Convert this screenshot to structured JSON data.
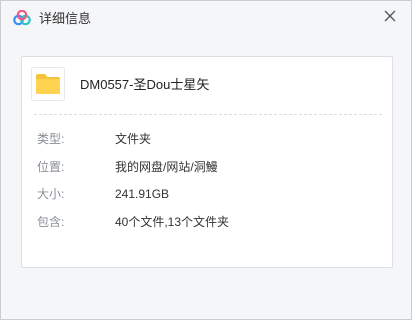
{
  "window": {
    "title": "详细信息",
    "logo_icon": "baidu-netdisk-logo",
    "close_icon": "close-icon"
  },
  "file": {
    "icon": "folder-icon",
    "icon_color": "#ffd34f",
    "name": "DM0557-圣Dou士星矢"
  },
  "details": {
    "type_label": "类型:",
    "type_value": "文件夹",
    "location_label": "位置:",
    "location_value": "我的网盘/网站/洞鰻",
    "size_label": "大小:",
    "size_value": "241.91GB",
    "contains_label": "包含:",
    "contains_value": "40个文件,13个文件夹"
  },
  "colors": {
    "background": "#f5f6f8",
    "panel": "#ffffff",
    "logo_blue": "#3a8ef6",
    "logo_pink": "#f05a7e",
    "logo_teal": "#2cc4c4"
  }
}
